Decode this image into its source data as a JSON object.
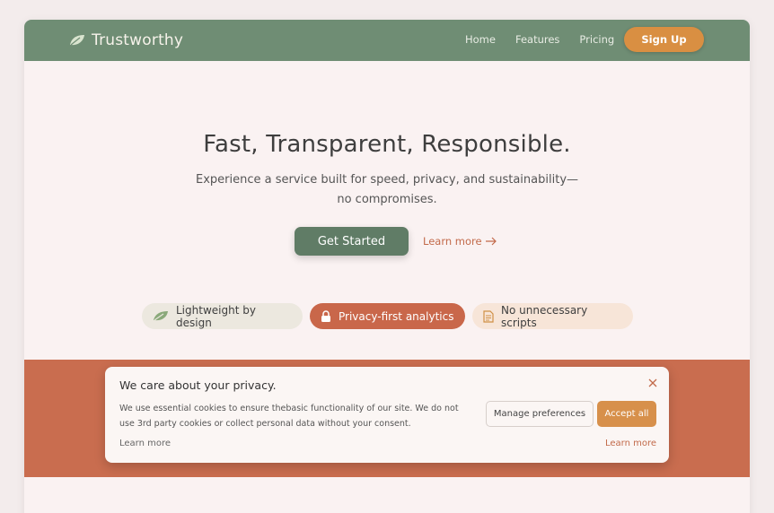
{
  "colors": {
    "nav_bg": "#6f8d74",
    "accent_orange": "#d98f42",
    "terracotta": "#c96d4f",
    "cta_green": "#607c66",
    "page_bg": "#faf2f2"
  },
  "header": {
    "brand": "Trustworthy",
    "brand_icon": "leaf-icon",
    "nav": [
      "Home",
      "Features",
      "Pricing"
    ],
    "signup_label": "Sign Up"
  },
  "hero": {
    "title": "Fast, Transparent, Responsible.",
    "subtitle": "Experience a service built for speed, privacy, and sustainability—no compromises.",
    "cta_label": "Get Started",
    "learn_more": "Learn more",
    "learn_more_icon": "arrow-right-icon"
  },
  "features": [
    {
      "label": "Lightweight by design",
      "icon": "leaf-icon"
    },
    {
      "label": "Privacy-first analytics",
      "icon": "lock-icon"
    },
    {
      "label": "No unnecessary scripts",
      "icon": "document-icon"
    }
  ],
  "cookie": {
    "title": "We care about your privacy.",
    "text": "We use essential cookies to ensure thebasic functionality of our site. We do not use 3rd party cookies or collect personal data without your consent.",
    "learn_more_left": "Learn more",
    "manage_label": "Manage preferences",
    "accept_label": "Accept all",
    "learn_more_right": "Learn more",
    "close_icon": "close-icon"
  }
}
